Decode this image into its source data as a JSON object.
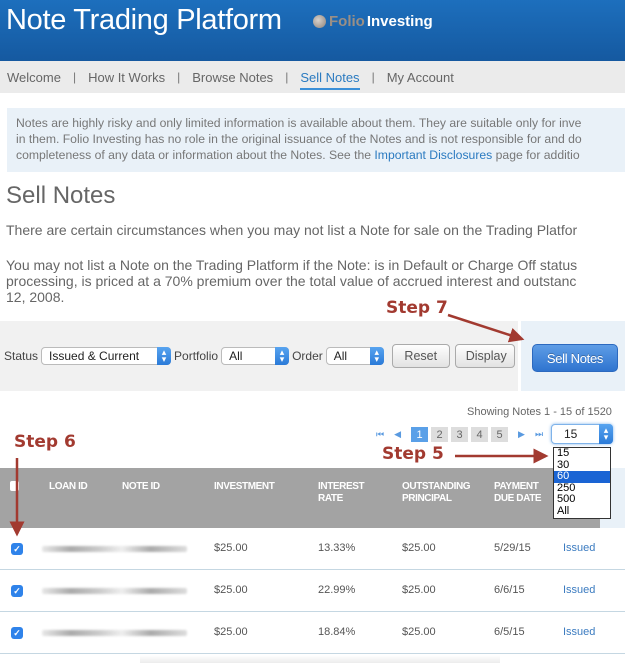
{
  "header": {
    "title": "Note Trading Platform",
    "logo_folio": "Folio",
    "logo_investing": "Investing"
  },
  "nav": {
    "items": [
      {
        "label": "Welcome",
        "active": false
      },
      {
        "label": "How It Works",
        "active": false
      },
      {
        "label": "Browse Notes",
        "active": false
      },
      {
        "label": "Sell Notes",
        "active": true
      },
      {
        "label": "My Account",
        "active": false
      }
    ],
    "separator": "|"
  },
  "disclaimer": {
    "line1": "Notes are highly risky and only limited information is available about them. They are suitable only for inve",
    "line2": "in them. Folio Investing has no role in the original issuance of the Notes and is not responsible for and do",
    "line3_before": "completeness of any data or information about the Notes. See the ",
    "link": "Important Disclosures",
    "line3_after": " page for additio"
  },
  "page": {
    "title": "Sell Notes",
    "para1": "There are certain circumstances when you may not list a Note for sale on the Trading Platfor",
    "para2_line1": "You may not list a Note on the Trading Platform if the Note: is in Default or Charge Off status",
    "para2_line2": "processing, is priced at a 70% premium over the total value of accrued interest and outstanc",
    "para2_line3": "12, 2008."
  },
  "filters": {
    "status_label": "Status",
    "status_value": "Issued & Current",
    "portfolio_label": "Portfolio",
    "portfolio_value": "All",
    "order_label": "Order",
    "order_value": "All",
    "reset_label": "Reset",
    "display_label": "Display",
    "sell_label": "Sell Notes"
  },
  "pagination": {
    "showing": "Showing Notes 1 - 15 of 1520",
    "pages": [
      "1",
      "2",
      "3",
      "4",
      "5"
    ],
    "current_page": "1",
    "first_icon": "⏮",
    "prev_icon": "◀",
    "next_icon": "▶",
    "last_icon": "⏭",
    "per_page_value": "15",
    "per_page_options": [
      "15",
      "30",
      "60",
      "250",
      "500",
      "All"
    ],
    "highlighted_option": "60"
  },
  "table": {
    "columns": [
      {
        "line1": "LOAN ID",
        "line2": ""
      },
      {
        "line1": "NOTE ID",
        "line2": ""
      },
      {
        "line1": "INVESTMENT",
        "line2": ""
      },
      {
        "line1": "INTEREST",
        "line2": "RATE"
      },
      {
        "line1": "OUTSTANDING",
        "line2": "PRINCIPAL"
      },
      {
        "line1": "PAYMENT",
        "line2": "DUE DATE"
      }
    ],
    "rows": [
      {
        "checked": true,
        "investment": "$25.00",
        "rate": "13.33%",
        "principal": "$25.00",
        "due": "5/29/15",
        "status": "Issued"
      },
      {
        "checked": true,
        "investment": "$25.00",
        "rate": "22.99%",
        "principal": "$25.00",
        "due": "6/6/15",
        "status": "Issued"
      },
      {
        "checked": true,
        "investment": "$25.00",
        "rate": "18.84%",
        "principal": "$25.00",
        "due": "6/5/15",
        "status": "Issued"
      }
    ]
  },
  "annotations": {
    "step5": "Step 5",
    "step6": "Step 6",
    "step7": "Step 7",
    "color": "#a23a30"
  },
  "colors": {
    "header_blue": "#1d6fbd",
    "accent_blue": "#2a7ac0",
    "table_header_gray": "#a3a3a3",
    "panel_light_blue": "#e9f1f8"
  }
}
